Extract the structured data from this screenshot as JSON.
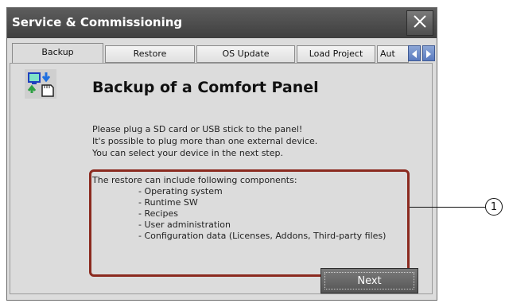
{
  "window": {
    "title": "Service & Commissioning"
  },
  "tabs": [
    {
      "label": "Backup",
      "active": true
    },
    {
      "label": "Restore",
      "active": false
    },
    {
      "label": "OS Update",
      "active": false
    },
    {
      "label": "Load Project",
      "active": false
    },
    {
      "label": "Aut",
      "active": false
    }
  ],
  "content": {
    "heading": "Backup of a Comfort Panel",
    "intro_lines": [
      "Please plug a SD card or USB stick to the panel!",
      "It's possible to plug more than one external device.",
      "You can select your device in the next step."
    ],
    "components_header": "The restore can include following components:",
    "components": [
      "- Operating system",
      "- Runtime SW",
      "- Recipes",
      "- User administration",
      "- Configuration data (Licenses, Addons, Third-party files)"
    ]
  },
  "buttons": {
    "next": "Next"
  },
  "callout": {
    "number": "1"
  },
  "icons": {
    "close": "close-icon",
    "scroll_left": "arrow-left-icon",
    "scroll_right": "arrow-right-icon",
    "backup": "backup-device-icon"
  },
  "colors": {
    "highlight": "#8b2a1f",
    "titlebar": "#4a4a4a",
    "scroll_buttons": "#5b7bbf"
  }
}
